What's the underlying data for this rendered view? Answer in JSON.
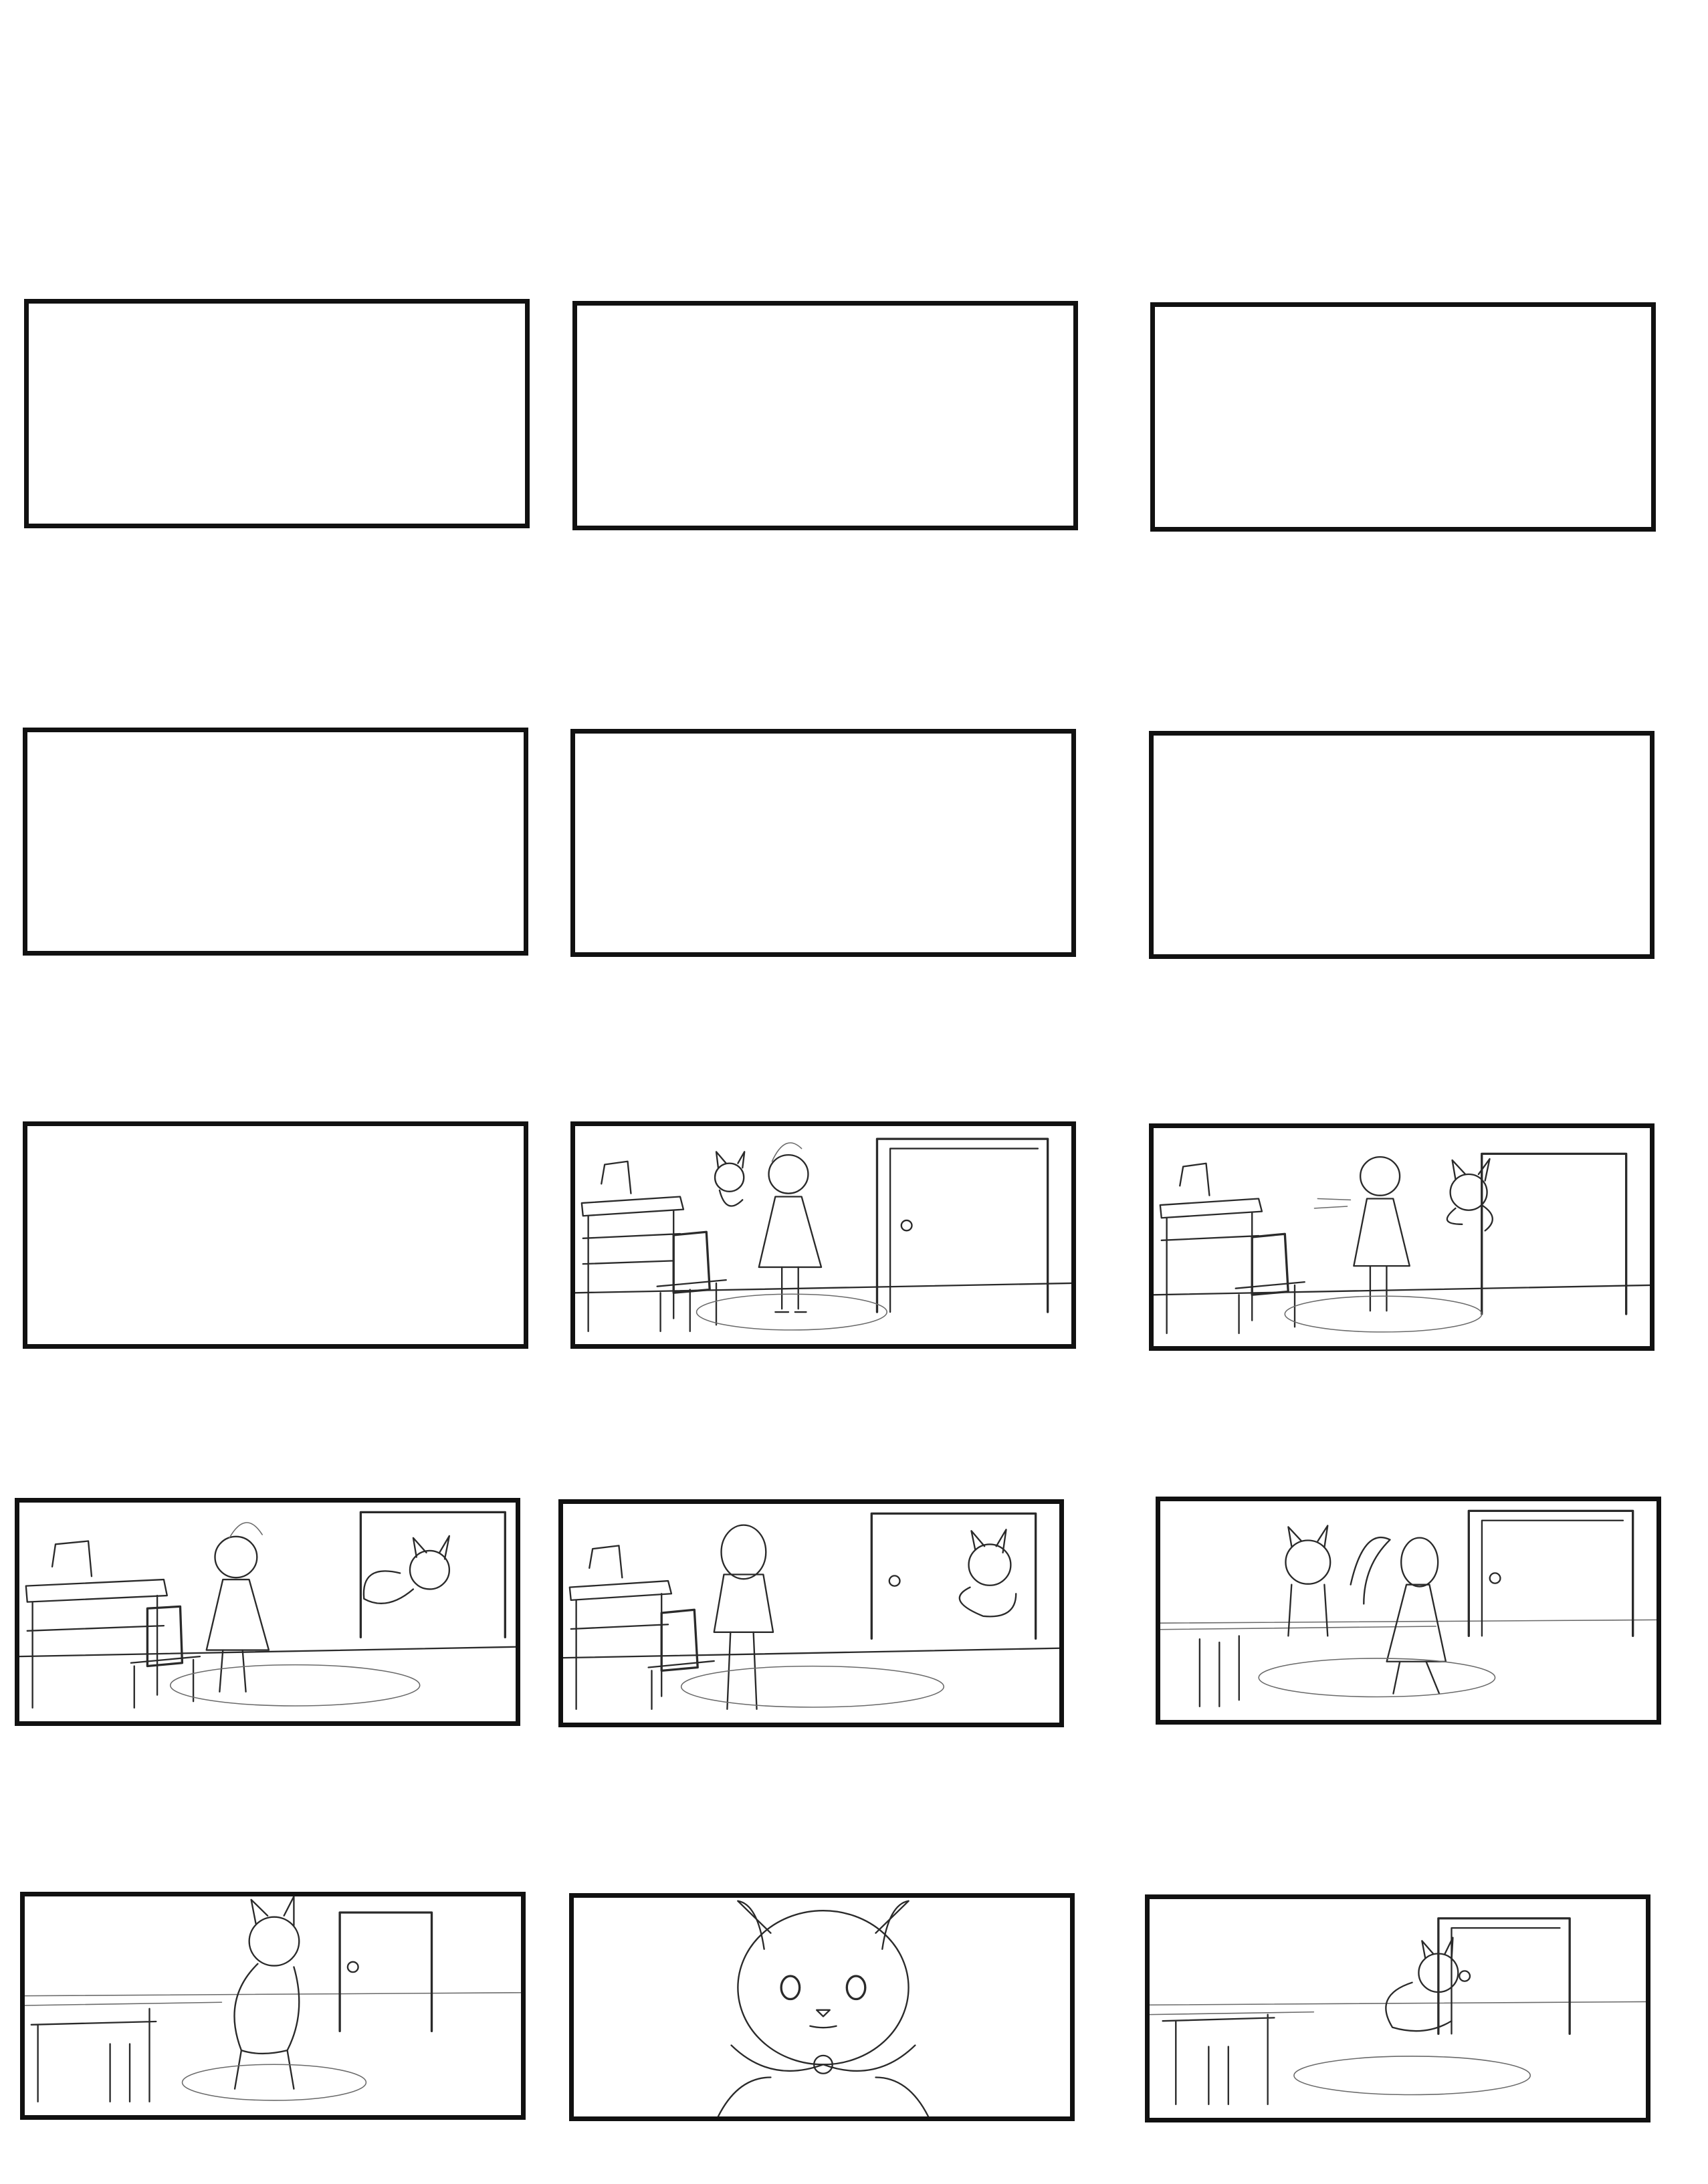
{
  "page": {
    "title": "",
    "background": "#ffffff",
    "border_color": "#111111"
  },
  "storyboard": {
    "rows": 5,
    "columns": 3,
    "panels": [
      {
        "id": 1,
        "content": "blank"
      },
      {
        "id": 2,
        "content": "blank"
      },
      {
        "id": 3,
        "content": "blank"
      },
      {
        "id": 4,
        "content": "blank"
      },
      {
        "id": 5,
        "content": "blank"
      },
      {
        "id": 6,
        "content": "blank"
      },
      {
        "id": 7,
        "content": "blank"
      },
      {
        "id": 8,
        "content": "sketch"
      },
      {
        "id": 9,
        "content": "sketch"
      },
      {
        "id": 10,
        "content": "sketch"
      },
      {
        "id": 11,
        "content": "sketch"
      },
      {
        "id": 12,
        "content": "sketch"
      },
      {
        "id": 13,
        "content": "sketch"
      },
      {
        "id": 14,
        "content": "sketch"
      },
      {
        "id": 15,
        "content": "sketch"
      }
    ]
  }
}
